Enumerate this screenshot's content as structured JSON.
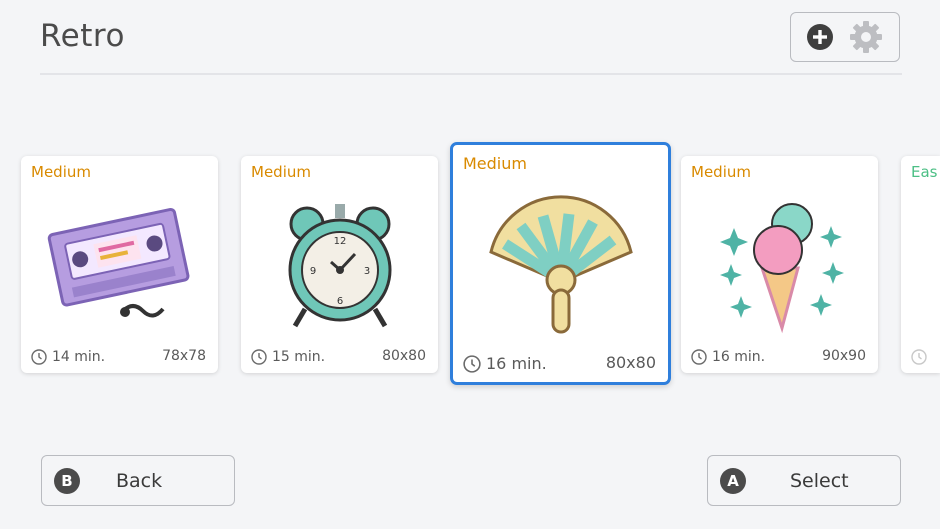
{
  "header": {
    "title": "Retro"
  },
  "top_actions": {
    "add_icon": "plus-circle-icon",
    "settings_icon": "gear-icon"
  },
  "cards": [
    {
      "difficulty": "Medium",
      "time": "14 min.",
      "size": "78x78",
      "art": "vhs-tape"
    },
    {
      "difficulty": "Medium",
      "time": "15 min.",
      "size": "80x80",
      "art": "alarm-clock"
    },
    {
      "difficulty": "Medium",
      "time": "16 min.",
      "size": "80x80",
      "art": "hand-fan",
      "selected": true
    },
    {
      "difficulty": "Medium",
      "time": "16 min.",
      "size": "90x90",
      "art": "ice-cream-cone"
    },
    {
      "difficulty": "Eas",
      "art": "partially-visible"
    }
  ],
  "footer": {
    "back": {
      "badge": "B",
      "label": "Back"
    },
    "select": {
      "badge": "A",
      "label": "Select"
    }
  },
  "colors": {
    "accent_selected": "#2f7fdc",
    "medium": "#d98a00",
    "easy": "#4cbf85"
  }
}
